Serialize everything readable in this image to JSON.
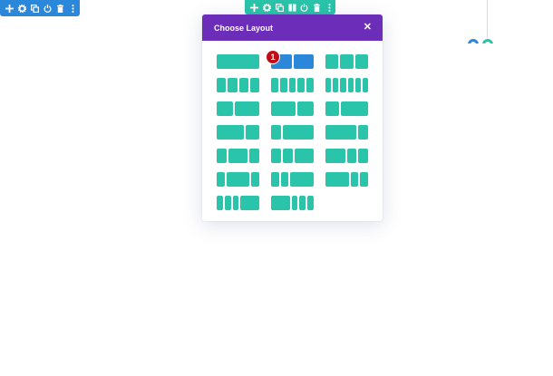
{
  "popup": {
    "title": "Choose Layout",
    "close_glyph": "✕",
    "header_color": "#6c2eb9"
  },
  "badge": {
    "number": "1"
  },
  "colors": {
    "blue": "#2b87da",
    "green": "#29c4a9",
    "badge_red": "#c00b14"
  },
  "section_toolbar": {
    "icons": [
      "plus-icon",
      "gear-icon",
      "duplicate-icon",
      "power-icon",
      "trash-icon",
      "more-icon"
    ]
  },
  "row_toolbar": {
    "icons": [
      "plus-icon",
      "gear-icon",
      "duplicate-icon",
      "columns-icon",
      "power-icon",
      "trash-icon",
      "more-icon"
    ]
  },
  "layouts": [
    {
      "ratio": [
        1
      ],
      "selected": false
    },
    {
      "ratio": [
        1,
        1
      ],
      "selected": true
    },
    {
      "ratio": [
        1,
        1,
        1
      ],
      "selected": false
    },
    {
      "ratio": [
        1,
        1,
        1,
        1
      ],
      "selected": false
    },
    {
      "ratio": [
        1,
        1,
        1,
        1,
        1
      ],
      "selected": false
    },
    {
      "ratio": [
        1,
        1,
        1,
        1,
        1,
        1
      ],
      "selected": false
    },
    {
      "ratio": [
        2,
        3
      ],
      "selected": false
    },
    {
      "ratio": [
        3,
        2
      ],
      "selected": false
    },
    {
      "ratio": [
        1,
        2
      ],
      "selected": false
    },
    {
      "ratio": [
        2,
        1
      ],
      "selected": false
    },
    {
      "ratio": [
        1,
        3
      ],
      "selected": false
    },
    {
      "ratio": [
        3,
        1
      ],
      "selected": false
    },
    {
      "ratio": [
        1,
        2,
        1
      ],
      "selected": false
    },
    {
      "ratio": [
        1,
        1,
        2
      ],
      "selected": false
    },
    {
      "ratio": [
        2,
        1,
        1
      ],
      "selected": false
    },
    {
      "ratio": [
        1,
        3,
        1
      ],
      "selected": false
    },
    {
      "ratio": [
        1,
        1,
        3
      ],
      "selected": false
    },
    {
      "ratio": [
        3,
        1,
        1
      ],
      "selected": false
    },
    {
      "ratio": [
        1,
        1,
        1,
        3
      ],
      "selected": false
    },
    {
      "ratio": [
        3,
        1,
        1,
        1
      ],
      "selected": false
    }
  ]
}
